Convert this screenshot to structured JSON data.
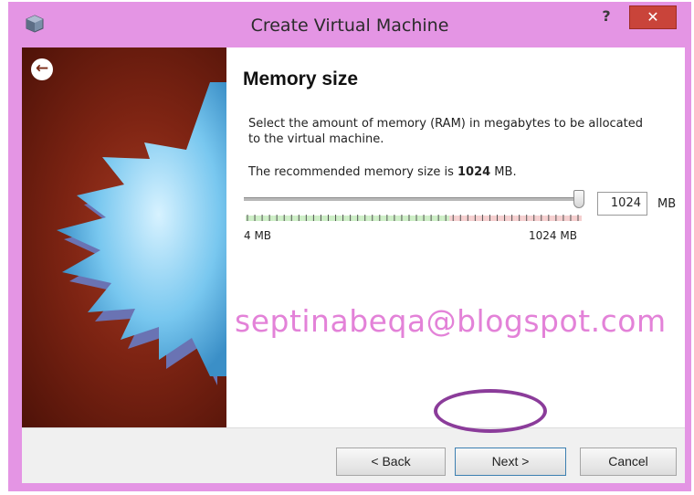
{
  "window": {
    "title": "Create Virtual Machine",
    "help_label": "?",
    "close_label": "✕"
  },
  "page": {
    "heading": "Memory size",
    "description": "Select the amount of memory (RAM) in megabytes to be allocated to the virtual machine.",
    "recommend_prefix": "The recommended memory size is ",
    "recommend_value": "1024",
    "recommend_suffix": " MB."
  },
  "memory": {
    "value": "1024",
    "unit": "MB",
    "min_label": "4 MB",
    "max_label": "1024 MB",
    "slider_fraction": 1.0
  },
  "watermark": "septinabeqa@blogspot.com",
  "buttons": {
    "back": "< Back",
    "next": "Next >",
    "cancel": "Cancel"
  },
  "colors": {
    "titlebar": "#e495e4",
    "close": "#c9443a",
    "ticks_ok": "#6fbf5f",
    "ticks_high": "#d97a7a",
    "watermark": "#e382d8",
    "highlight": "#8b3c9a"
  },
  "icons": {
    "app": "virtualbox-icon",
    "back": "back-arrow-icon"
  }
}
